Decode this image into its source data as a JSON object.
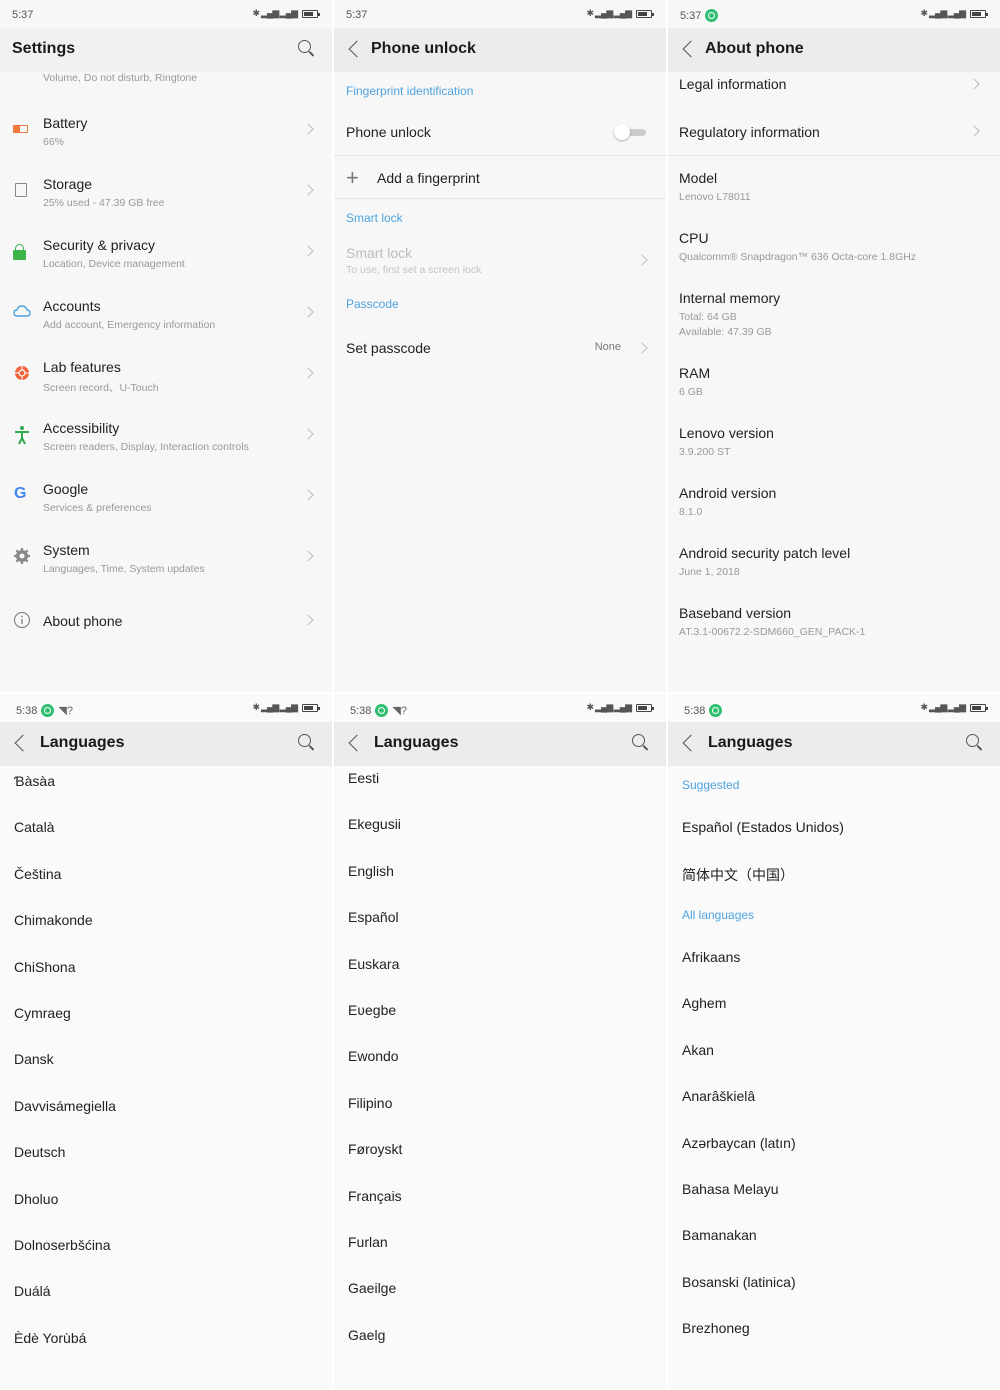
{
  "panels": {
    "settings": {
      "time": "5:37",
      "title": "Settings",
      "partial_item": "Volume, Do not disturb, Ringtone",
      "items": [
        {
          "title": "Battery",
          "subtitle": "66%"
        },
        {
          "title": "Storage",
          "subtitle": "25% used - 47.39 GB free"
        },
        {
          "title": "Security & privacy",
          "subtitle": "Location, Device management"
        },
        {
          "title": "Accounts",
          "subtitle": "Add account, Emergency information"
        },
        {
          "title": "Lab features",
          "subtitle": "Screen record、U-Touch"
        },
        {
          "title": "Accessibility",
          "subtitle": "Screen readers, Display, Interaction controls"
        },
        {
          "title": "Google",
          "subtitle": "Services & preferences"
        },
        {
          "title": "System",
          "subtitle": "Languages, Time, System updates"
        },
        {
          "title": "About phone",
          "subtitle": ""
        }
      ],
      "icons": [
        "battery-icon",
        "storage-icon",
        "lock-icon",
        "cloud-icon",
        "lab-icon",
        "accessibility-icon",
        "google-icon",
        "gear-icon",
        "info-icon"
      ]
    },
    "phone_unlock": {
      "time": "5:37",
      "title": "Phone unlock",
      "section_fingerprint": "Fingerprint identification",
      "phone_unlock_label": "Phone unlock",
      "add_fingerprint": "Add a fingerprint",
      "section_smart_lock": "Smart lock",
      "smart_lock_title": "Smart lock",
      "smart_lock_subtitle": "To use, first set a screen lock",
      "section_passcode": "Passcode",
      "set_passcode": "Set passcode",
      "passcode_value": "None"
    },
    "about": {
      "time": "5:37",
      "title": "About phone",
      "legal": "Legal information",
      "regulatory": "Regulatory information",
      "specs": [
        {
          "label": "Model",
          "value": "Lenovo L78011",
          "value2": ""
        },
        {
          "label": "CPU",
          "value": "Qualcomm® Snapdragon™ 636 Octa-core 1.8GHz",
          "value2": ""
        },
        {
          "label": "Internal memory",
          "value": "Total: 64 GB",
          "value2": "Available: 47.39 GB"
        },
        {
          "label": "RAM",
          "value": "6 GB",
          "value2": ""
        },
        {
          "label": "Lenovo version",
          "value": "3.9.200 ST",
          "value2": ""
        },
        {
          "label": "Android version",
          "value": "8.1.0",
          "value2": ""
        },
        {
          "label": "Android security patch level",
          "value": "June 1, 2018",
          "value2": ""
        },
        {
          "label": "Baseband version",
          "value": "AT.3.1-00672.2-SDM660_GEN_PACK-1",
          "value2": ""
        }
      ]
    },
    "languages1": {
      "time": "5:38",
      "title": "Languages",
      "items": [
        "Ɓàsàa",
        "Català",
        "Čeština",
        "Chimakonde",
        "ChiShona",
        "Cymraeg",
        "Dansk",
        "Davvisámegiella",
        "Deutsch",
        "Dholuo",
        "Dolnoserbšćina",
        "Duálá",
        "Èdè Yorùbá"
      ]
    },
    "languages2": {
      "time": "5:38",
      "title": "Languages",
      "items": [
        "Eesti",
        "Ekegusii",
        "English",
        "Español",
        "Euskara",
        "Eʋegbe",
        "Ewondo",
        "Filipino",
        "Føroyskt",
        "Français",
        "Furlan",
        "Gaeilge",
        "Gaelg"
      ]
    },
    "languages3": {
      "time": "5:38",
      "title": "Languages",
      "section_suggested": "Suggested",
      "suggested": [
        "Español (Estados Unidos)",
        "简体中文（中国）"
      ],
      "section_all": "All languages",
      "items": [
        "Afrikaans",
        "Aghem",
        "Akan",
        "Anarâškielâ",
        "Azərbaycan (latın)",
        "Bahasa Melayu",
        "Bamanakan",
        "Bosanski (latinica)",
        "Brezhoneg"
      ]
    }
  },
  "colors": {
    "accent": "#4ea3e0",
    "battery": "#f07a3c",
    "security": "#3cb34a",
    "accounts": "#4ea3e0",
    "lab": "#f0643c",
    "accessibility": "#2fa84f",
    "google": "#4285f4",
    "status_dot": "#2fbf71"
  }
}
